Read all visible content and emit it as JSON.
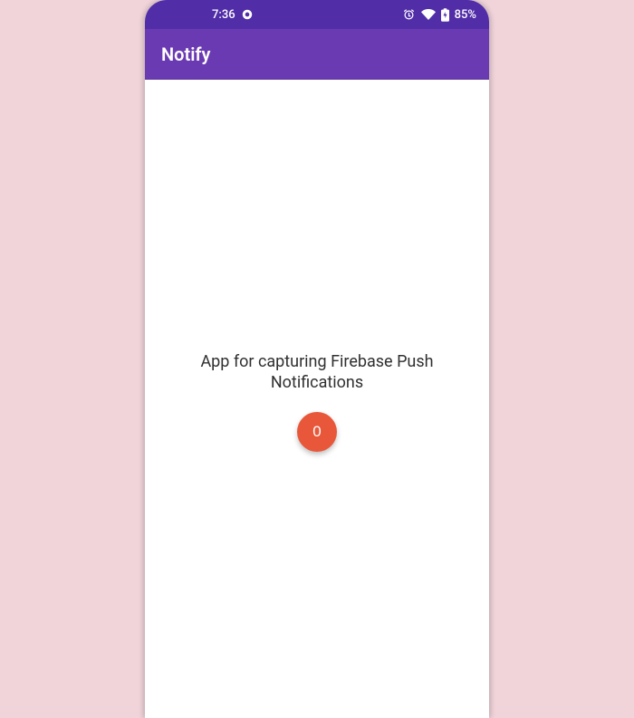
{
  "status_bar": {
    "time": "7:36",
    "battery": "85%"
  },
  "app_bar": {
    "title": "Notify"
  },
  "main": {
    "description": "App for capturing Firebase Push Notifications",
    "counter": "0"
  }
}
